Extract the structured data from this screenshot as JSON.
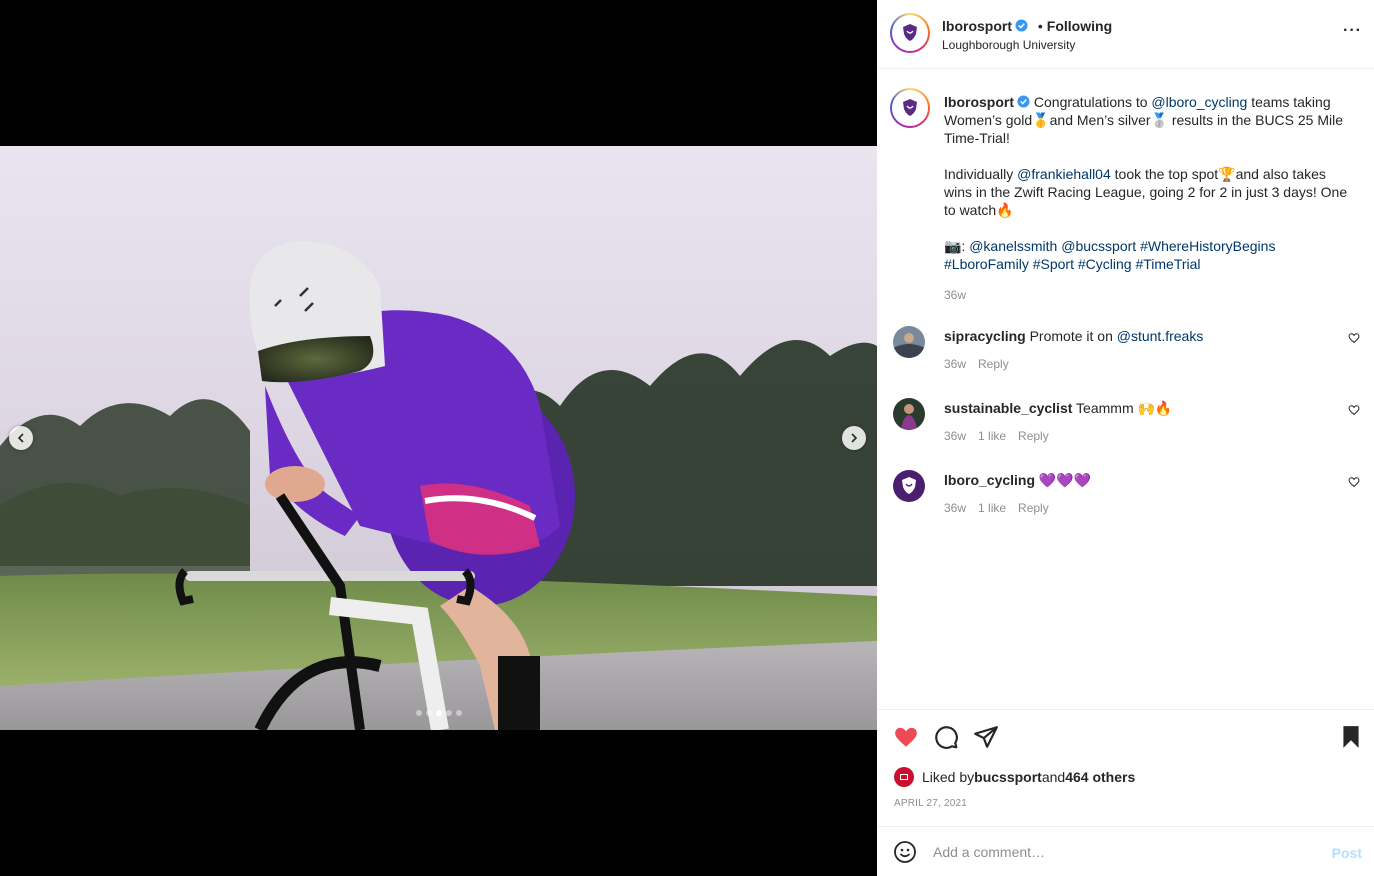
{
  "post": {
    "username": "lborosport",
    "location": "Loughborough University",
    "follow_separator": "•",
    "follow_label": "Following",
    "more_label": "···"
  },
  "caption": {
    "username": "lborosport",
    "line1_pre": "Congratulations to ",
    "line1_mention": "@lboro_cycling",
    "line1_post": " teams taking Women’s gold🥇and Men’s silver🥈 results in the BUCS 25 Mile Time-Trial!",
    "para2_pre": "Individually ",
    "para2_mention": "@frankiehall04",
    "para2_post": " took the top spot🏆and also takes wins in the Zwift Racing League, going 2 for 2 in just 3 days! One to watch🔥",
    "para3_pre": "📷: ",
    "para3_tags": [
      "@kanelssmith",
      "@bucssport",
      "#WhereHistoryBegins",
      "#LboroFamily",
      "#Sport",
      "#Cycling",
      "#TimeTrial"
    ],
    "time": "36w"
  },
  "comments": [
    {
      "username": "sipracycling",
      "text_pre": "Promote it on ",
      "mention": "@stunt.freaks",
      "text_post": "",
      "time": "36w",
      "likes": "",
      "reply": "Reply"
    },
    {
      "username": "sustainable_cyclist",
      "text_pre": "Teammm 🙌🔥",
      "mention": "",
      "text_post": "",
      "time": "36w",
      "likes": "1 like",
      "reply": "Reply"
    },
    {
      "username": "lboro_cycling",
      "text_pre": "💜💜💜",
      "mention": "",
      "text_post": "",
      "time": "36w",
      "likes": "1 like",
      "reply": "Reply"
    }
  ],
  "actions": {
    "liked_by_pre": "Liked by ",
    "liked_by_user": "bucssport",
    "liked_by_mid": " and ",
    "liked_by_count": "464 others",
    "date": "APRIL 27, 2021"
  },
  "comment_box": {
    "placeholder": "Add a comment…",
    "post_label": "Post"
  },
  "carousel": {
    "total": 5,
    "active": 2
  },
  "colors": {
    "like_red": "#ed4956",
    "link": "#00376b",
    "verified": "#3897f0",
    "jersey": "#6a2bc4"
  }
}
